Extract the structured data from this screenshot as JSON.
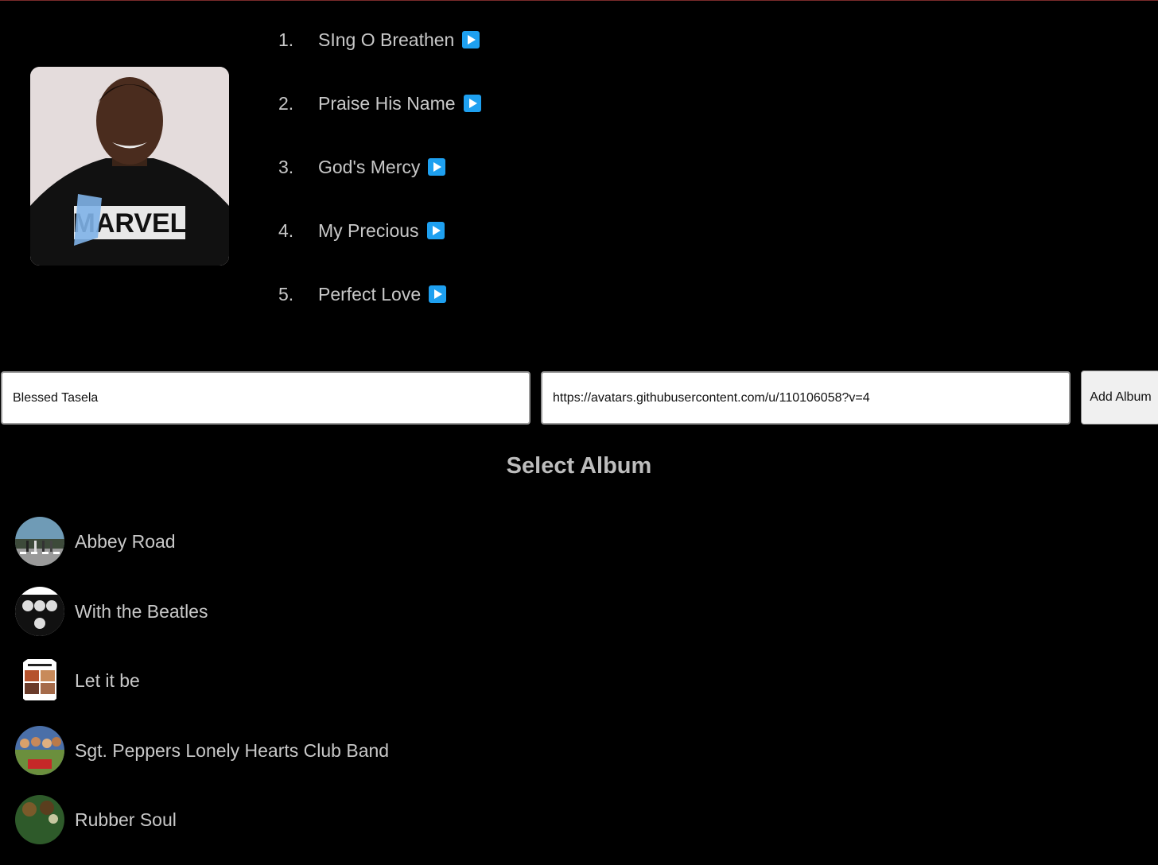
{
  "tracks": [
    {
      "number": "1.",
      "title": "SIng O Breathen"
    },
    {
      "number": "2.",
      "title": "Praise His Name"
    },
    {
      "number": "3.",
      "title": "God's Mercy"
    },
    {
      "number": "4.",
      "title": "My Precious"
    },
    {
      "number": "5.",
      "title": "Perfect Love"
    }
  ],
  "form": {
    "name_value": "Blessed Tasela",
    "url_value": "https://avatars.githubusercontent.com/u/110106058?v=4",
    "add_label": "Add Album"
  },
  "select_title": "Select Album",
  "albums": [
    {
      "title": "Abbey Road"
    },
    {
      "title": "With the Beatles"
    },
    {
      "title": "Let it be"
    },
    {
      "title": "Sgt. Peppers Lonely Hearts Club Band"
    },
    {
      "title": "Rubber Soul"
    }
  ],
  "colors": {
    "background": "#000000",
    "text": "#c8c8c8",
    "play_button": "#1ea0f0"
  }
}
